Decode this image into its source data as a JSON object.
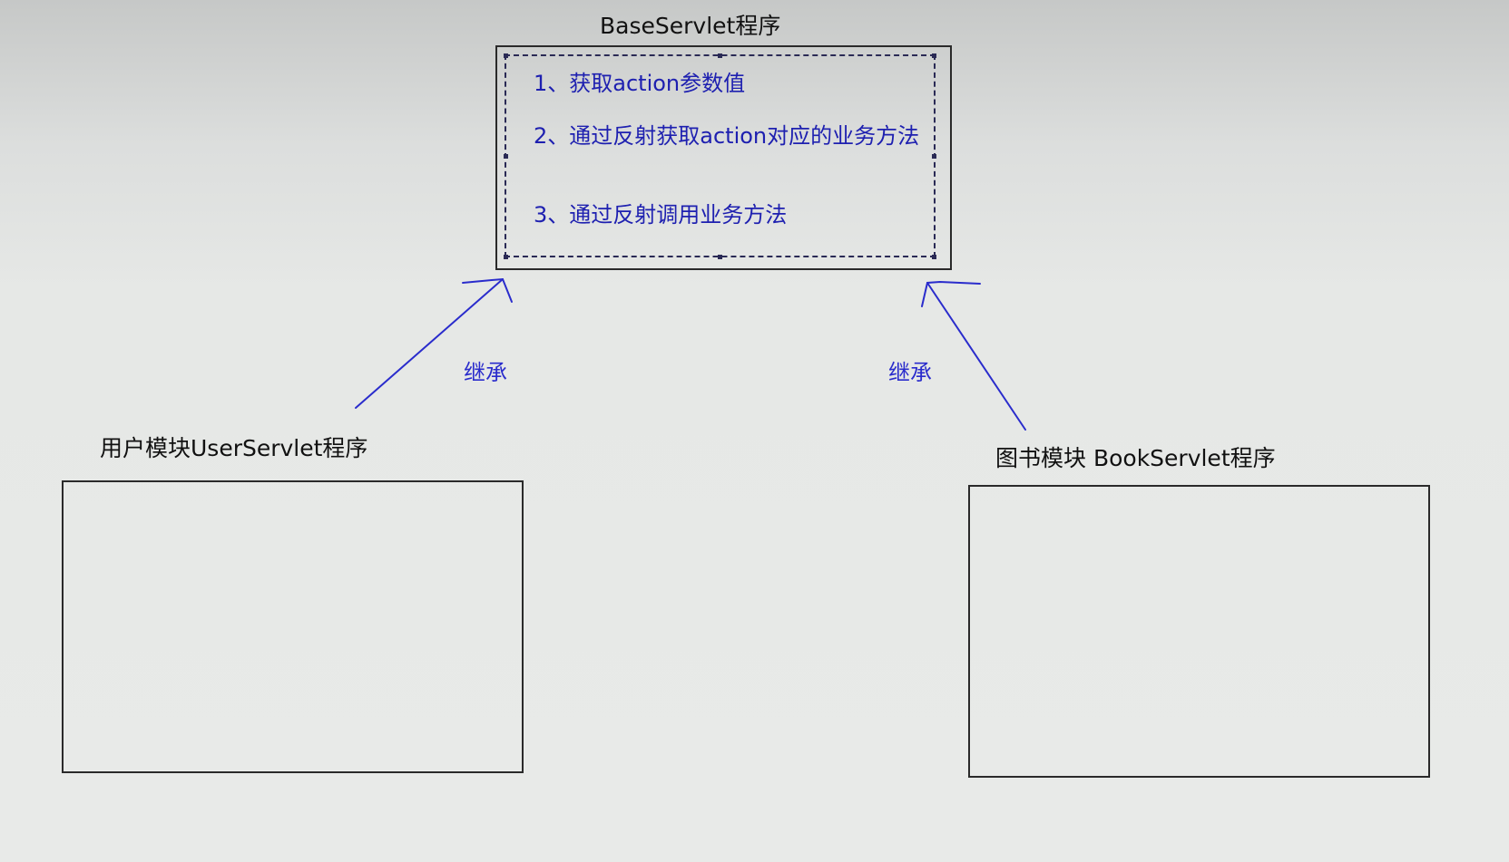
{
  "base": {
    "title": "BaseServlet程序",
    "steps": [
      "1、获取action参数值",
      "2、通过反射获取action对应的业务方法",
      "3、通过反射调用业务方法"
    ]
  },
  "user_module": {
    "title": "用户模块UserServlet程序"
  },
  "book_module": {
    "title": "图书模块 BookServlet程序"
  },
  "relations": {
    "left_label": "继承",
    "right_label": "继承"
  },
  "colors": {
    "annotation": "#2a2ccc",
    "box_border": "#2a2a2a",
    "text": "#111111"
  }
}
